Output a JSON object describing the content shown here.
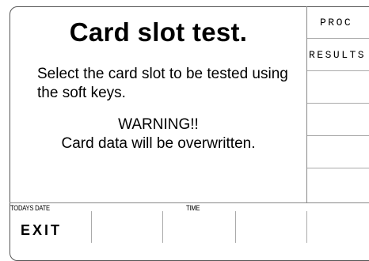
{
  "screen": {
    "title": "Card slot test.",
    "instruction": "Select the card slot to be tested using the soft keys.",
    "warning_line1": "WARNING!!",
    "warning_line2": "Card data will be overwritten."
  },
  "softkeys": [
    {
      "label": "PROC"
    },
    {
      "label": "RESULTS"
    },
    {
      "label": ""
    },
    {
      "label": ""
    },
    {
      "label": ""
    },
    {
      "label": ""
    }
  ],
  "status_bar": {
    "date_label": "TODAYS DATE",
    "time_label": "TIME"
  },
  "bottom_keys": [
    {
      "label": "EXIT"
    },
    {
      "label": ""
    },
    {
      "label": ""
    },
    {
      "label": ""
    },
    {
      "label": ""
    }
  ]
}
